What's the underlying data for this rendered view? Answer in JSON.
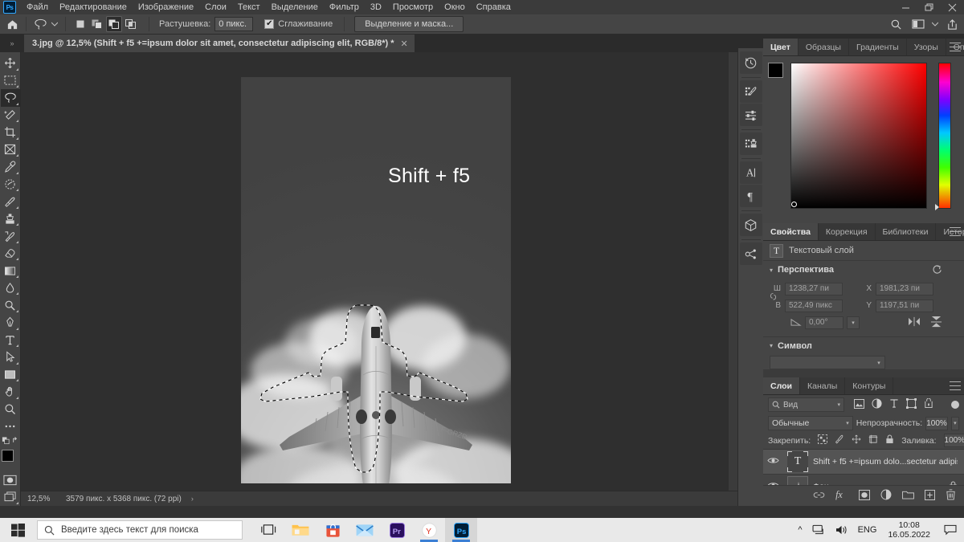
{
  "app": {
    "name": "Adobe Photoshop",
    "logo_text": "Ps"
  },
  "menubar": {
    "items": [
      {
        "label": "Файл"
      },
      {
        "label": "Редактирование"
      },
      {
        "label": "Изображение"
      },
      {
        "label": "Слои"
      },
      {
        "label": "Текст"
      },
      {
        "label": "Выделение"
      },
      {
        "label": "Фильтр"
      },
      {
        "label": "3D"
      },
      {
        "label": "Просмотр"
      },
      {
        "label": "Окно"
      },
      {
        "label": "Справка"
      }
    ],
    "window_controls": {
      "minimize": "—",
      "maximize": "❐",
      "close": "✕"
    }
  },
  "optionsbar": {
    "home_icon": "home-icon",
    "tool_icon": "lasso-icon",
    "selection_modes": [
      "new-selection",
      "add-to-selection",
      "subtract-from-selection",
      "intersect-selection"
    ],
    "active_selection_mode": "subtract-from-selection",
    "feather_label": "Растушевка:",
    "feather_value": "0 пикс.",
    "antialias_label": "Сглаживание",
    "antialias_checked": "✔",
    "select_mask_button": "Выделение и маска...",
    "right_icons": [
      "search-icon",
      "workspace-icon",
      "chevron-down-icon",
      "share-icon"
    ]
  },
  "tabbar": {
    "collapse_icon": "»",
    "document_tab": "3.jpg @ 12,5% (Shift + f5  +=ipsum dolor sit amet, consectetur adipiscing elit, RGB/8*) *",
    "close_icon": "✕"
  },
  "toolbar": {
    "tools": [
      {
        "name": "move-tool",
        "label": "Перемещение"
      },
      {
        "name": "rectangular-marquee-tool",
        "label": "Прямоугольная область"
      },
      {
        "name": "lasso-tool",
        "label": "Лассо",
        "active": true
      },
      {
        "name": "quick-selection-tool",
        "label": "Быстрое выделение"
      },
      {
        "name": "crop-tool",
        "label": "Рамка"
      },
      {
        "name": "frame-tool",
        "label": "Кадр"
      },
      {
        "name": "eyedropper-tool",
        "label": "Пипетка"
      },
      {
        "name": "spot-healing-brush-tool",
        "label": "Точечная восстанавливающая кисть"
      },
      {
        "name": "brush-tool",
        "label": "Кисть"
      },
      {
        "name": "clone-stamp-tool",
        "label": "Штамп"
      },
      {
        "name": "history-brush-tool",
        "label": "Архивная кисть"
      },
      {
        "name": "eraser-tool",
        "label": "Ластик"
      },
      {
        "name": "gradient-tool",
        "label": "Градиент"
      },
      {
        "name": "blur-tool",
        "label": "Размытие"
      },
      {
        "name": "dodge-tool",
        "label": "Осветлитель"
      },
      {
        "name": "pen-tool",
        "label": "Перо"
      },
      {
        "name": "horizontal-type-tool",
        "label": "Горизонтальный текст"
      },
      {
        "name": "path-selection-tool",
        "label": "Выделение контура"
      },
      {
        "name": "rectangle-tool",
        "label": "Прямоугольник"
      },
      {
        "name": "hand-tool",
        "label": "Рука"
      },
      {
        "name": "zoom-tool",
        "label": "Масштаб"
      },
      {
        "name": "edit-toolbar-tool",
        "label": "..."
      }
    ],
    "foreground_color": "#000000",
    "background_color": "#ffffff",
    "quickmask_icon": "quick-mask-icon",
    "screenmode_icon": "screen-mode-icon"
  },
  "canvas": {
    "artboard_text": "Shift + f5",
    "zoom": "12,5%",
    "document_size": "3579 пикс. x 5368 пикс. (72 ppi)",
    "status_arrow": "›",
    "selection_active": true,
    "selection_subject": "airplane"
  },
  "rail": {
    "icons": [
      {
        "name": "history-icon"
      },
      {
        "name": "brush-settings-icon"
      },
      {
        "name": "adjustments-icon"
      },
      {
        "name": "clone-source-icon"
      },
      {
        "name": "character-icon"
      },
      {
        "name": "paragraph-icon"
      },
      {
        "name": "3d-icon"
      },
      {
        "name": "paths-icon"
      }
    ]
  },
  "color_panel": {
    "tabs": [
      {
        "label": "Цвет",
        "active": true
      },
      {
        "label": "Образцы",
        "active": false
      },
      {
        "label": "Градиенты",
        "active": false
      },
      {
        "label": "Узоры",
        "active": false
      },
      {
        "label": "Операции",
        "active": false
      }
    ],
    "foreground_color": "#000000",
    "background_color": "#ffffff",
    "field_base_hue": "#ff0000"
  },
  "properties_panel": {
    "tabs": [
      {
        "label": "Свойства",
        "active": true
      },
      {
        "label": "Коррекция",
        "active": false
      },
      {
        "label": "Библиотеки",
        "active": false
      },
      {
        "label": "История",
        "active": false
      }
    ],
    "layer_type": "Текстовый слой",
    "layer_type_icon": "T",
    "sections": {
      "transform": {
        "title": "Перспектива",
        "reset_icon": "reset-icon",
        "fields": [
          {
            "label": "Ш",
            "value": "1238,27 пи"
          },
          {
            "label": "X",
            "value": "1981,23 пи"
          },
          {
            "label": "В",
            "value": "522,49 пикс"
          },
          {
            "label": "Y",
            "value": "1197,51 пи"
          }
        ],
        "angle_label": "angle-icon",
        "angle_value": "0,00°",
        "flip_horizontal_icon": "flip-horizontal-icon",
        "flip_vertical_icon": "flip-vertical-icon"
      },
      "character": {
        "title": "Символ",
        "font_value": ""
      }
    }
  },
  "layers_panel": {
    "tabs": [
      {
        "label": "Слои",
        "active": true
      },
      {
        "label": "Каналы",
        "active": false
      },
      {
        "label": "Контуры",
        "active": false
      }
    ],
    "filter_select": "Вид",
    "filter_icons": [
      "pixels-filter-icon",
      "adjustment-filter-icon",
      "type-filter-icon",
      "shape-filter-icon",
      "smart-object-filter-icon"
    ],
    "blend_mode": "Обычные",
    "opacity_label": "Непрозрачность:",
    "opacity_value": "100%",
    "lock_label": "Закрепить:",
    "lock_icons": [
      "lock-transparent-icon",
      "lock-image-icon",
      "lock-position-icon",
      "lock-artboard-icon",
      "lock-all-icon"
    ],
    "fill_label": "Заливка:",
    "fill_value": "100%",
    "layers": [
      {
        "name": "Shift + f5  +=ipsum dolo...sectetur adipiscing elit",
        "type": "text",
        "visible": true,
        "selected": true,
        "locked": false,
        "thumb_icon": "T"
      },
      {
        "name": "Фон",
        "type": "image",
        "visible": true,
        "selected": false,
        "locked": true,
        "lock_icon": "lock-icon"
      }
    ],
    "footer_icons": [
      {
        "name": "link-layers-icon",
        "glyph": "🔗"
      },
      {
        "name": "layer-style-icon",
        "glyph": "fx"
      },
      {
        "name": "layer-mask-icon",
        "glyph": "▣"
      },
      {
        "name": "adjustment-layer-icon",
        "glyph": "◑"
      },
      {
        "name": "new-group-icon",
        "glyph": "▤"
      },
      {
        "name": "new-layer-icon",
        "glyph": "⊞"
      },
      {
        "name": "delete-layer-icon",
        "glyph": "🗑"
      }
    ]
  },
  "taskbar": {
    "start_icon": "windows-start-icon",
    "search_placeholder": "Введите здесь текст для поиска",
    "search_icon": "search-icon",
    "taskview_icon": "task-view-icon",
    "apps": [
      {
        "name": "file-explorer-icon",
        "label": "Проводник",
        "running": false
      },
      {
        "name": "microsoft-store-icon",
        "label": "Microsoft Store",
        "running": false
      },
      {
        "name": "mail-icon",
        "label": "Почта",
        "running": false
      },
      {
        "name": "premiere-pro-icon",
        "label": "Pr",
        "running": false
      },
      {
        "name": "yandex-browser-icon",
        "label": "Y",
        "running": true
      },
      {
        "name": "photoshop-icon",
        "label": "Ps",
        "running": true,
        "active": true
      }
    ],
    "tray": {
      "expand_icon": "^",
      "network_icon": "network-icon",
      "volume_icon": "volume-icon",
      "language": "ENG",
      "time": "10:08",
      "date": "16.05.2022",
      "notification_icon": "notification-icon"
    }
  }
}
